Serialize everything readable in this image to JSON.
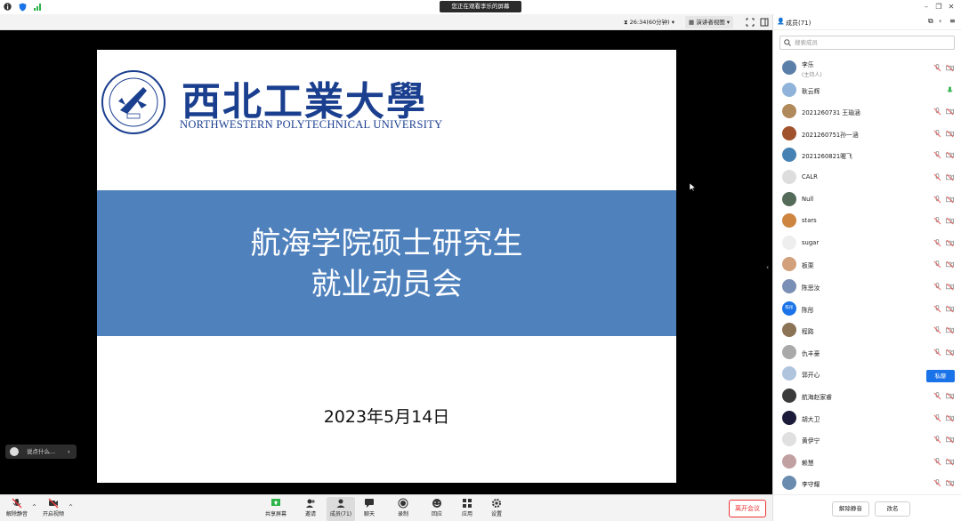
{
  "titlebar": {
    "banner": "您正在观看李乐的屏幕"
  },
  "meetbar": {
    "timer": "26:34(60分钟)",
    "view_mode": "演讲者视图"
  },
  "slide": {
    "uni_cn": "西北工業大學",
    "uni_en": "NORTHWESTERN POLYTECHNICAL UNIVERSITY",
    "title_line1": "航海学院硕士研究生",
    "title_line2": "就业动员会",
    "date": "2023年5月14日"
  },
  "chat": {
    "preview": "说点什么..."
  },
  "toolbar": {
    "unmute": "解除静音",
    "start_video": "开启视频",
    "share": "共享屏幕",
    "invite": "邀请",
    "members": "成员(71)",
    "chat": "聊天",
    "record": "录制",
    "reactions": "回应",
    "apps": "应用",
    "settings": "设置",
    "leave": "离开会议"
  },
  "panel": {
    "title": "成员(71)",
    "search_placeholder": "搜索成员",
    "members": [
      {
        "name": "李乐",
        "sub": "(主持人)",
        "color": "#5a7fa8"
      },
      {
        "name": "耿云辉",
        "sub": "",
        "color": "#8fb3d9",
        "mic_on": true
      },
      {
        "name": "2021260731   王瑜涵",
        "sub": "",
        "color": "#b08a5a"
      },
      {
        "name": "2021260751孙一涵",
        "sub": "",
        "color": "#a0522d"
      },
      {
        "name": "2021260821喔飞",
        "sub": "",
        "color": "#4682b4"
      },
      {
        "name": "CALR",
        "sub": "",
        "color": "#dddddd"
      },
      {
        "name": "Null",
        "sub": "",
        "color": "#556b5a"
      },
      {
        "name": "stars",
        "sub": "",
        "color": "#cd853f"
      },
      {
        "name": "sugar",
        "sub": "",
        "color": "#eeeeee"
      },
      {
        "name": "板栗",
        "sub": "",
        "color": "#d2a07a"
      },
      {
        "name": "陈思汝",
        "sub": "",
        "color": "#7a8fb5"
      },
      {
        "name": "陈彤",
        "sub": "",
        "color": "#1a73e8",
        "badge": "陈彤"
      },
      {
        "name": "程路",
        "sub": "",
        "color": "#8b7355"
      },
      {
        "name": "仇丰豪",
        "sub": "",
        "color": "#a9a9a9"
      },
      {
        "name": "郭开心",
        "sub": "",
        "color": "#b0c4de",
        "action": "私聊"
      },
      {
        "name": "航海赵家睿",
        "sub": "",
        "color": "#3b3b3b"
      },
      {
        "name": "胡大卫",
        "sub": "",
        "color": "#1c1c3a"
      },
      {
        "name": "黄伊宁",
        "sub": "",
        "color": "#e0e0e0"
      },
      {
        "name": "赖慧",
        "sub": "",
        "color": "#c0a0a0"
      },
      {
        "name": "李守耀",
        "sub": "",
        "color": "#6a8caf"
      }
    ],
    "unmute_all": "解除静音",
    "rename": "改名"
  }
}
